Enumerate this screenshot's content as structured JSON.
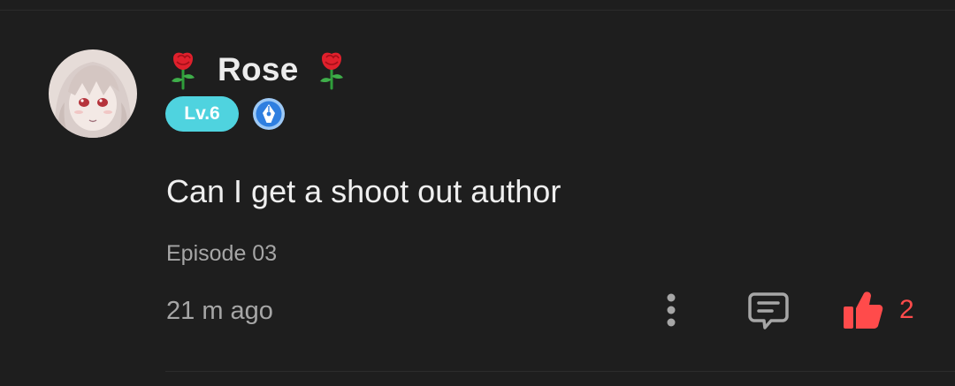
{
  "comment": {
    "user": {
      "name": "Rose",
      "decoration_icon": "rose-icon",
      "level": "Lv.6",
      "badge_icon": "pen-nib-badge-icon",
      "avatar_icon": "anime-avatar"
    },
    "text": "Can I get a shoot out author",
    "episode": "Episode 03",
    "time": "21 m ago",
    "actions": {
      "more_icon": "more-vertical-icon",
      "reply_icon": "reply-comment-icon",
      "like_icon": "thumbs-up-icon",
      "like_count": "2"
    }
  },
  "colors": {
    "background": "#1e1e1e",
    "level_badge": "#4fd3df",
    "like_accent": "#ff4b4b",
    "muted_text": "#a6a6a6",
    "primary_text": "#ececec"
  }
}
